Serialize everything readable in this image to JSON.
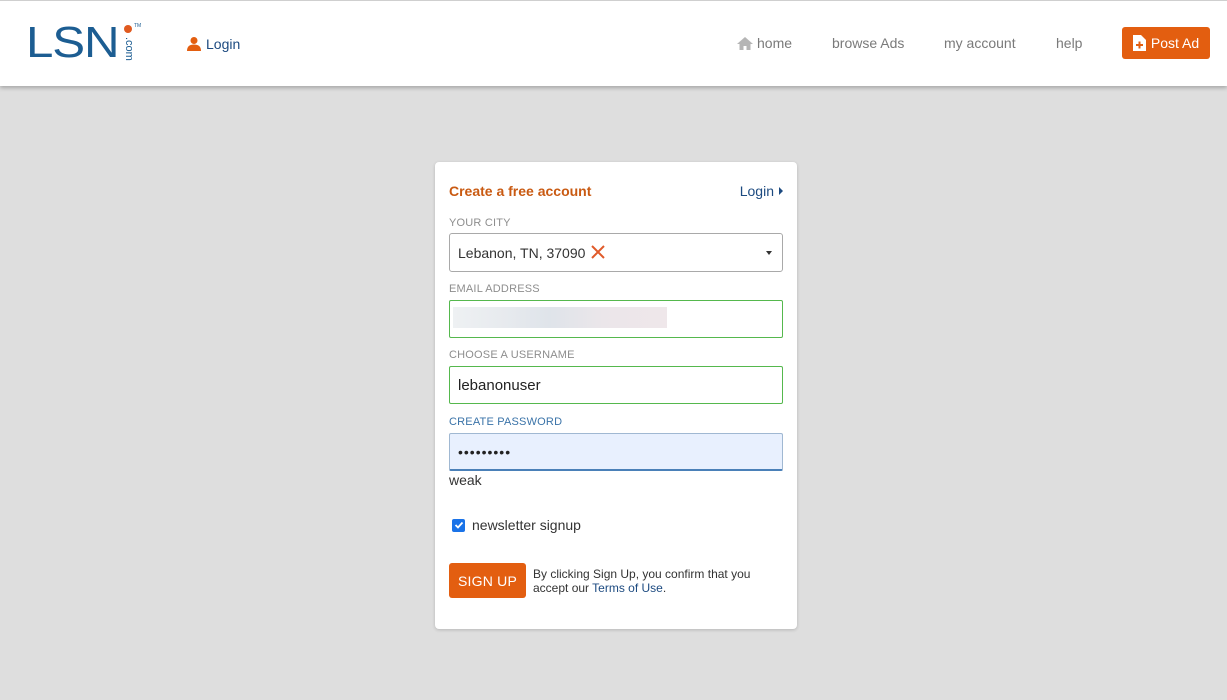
{
  "header": {
    "logo_text": "LSN",
    "logo_suffix": ".com",
    "logo_tm": "TM",
    "login_label": "Login",
    "nav": {
      "home": "home",
      "browse": "browse Ads",
      "account": "my account",
      "help": "help"
    },
    "post_ad_label": "Post Ad"
  },
  "form": {
    "title": "Create a free account",
    "login_link": "Login",
    "city_label": "YOUR CITY",
    "city_value": "Lebanon, TN, 37090",
    "email_label": "EMAIL ADDRESS",
    "email_value": "",
    "username_label": "CHOOSE A USERNAME",
    "username_value": "lebanonuser",
    "password_label": "CREATE PASSWORD",
    "password_value": "•••••••••",
    "password_strength": "weak",
    "newsletter_label": "newsletter signup",
    "newsletter_checked": true,
    "signup_label": "SIGN UP",
    "terms_prefix": "By clicking Sign Up, you confirm that you accept our ",
    "terms_link": "Terms of Use",
    "terms_suffix": "."
  },
  "colors": {
    "brand_blue": "#1c5d92",
    "accent_orange": "#e35e10",
    "valid_green": "#55b84d",
    "background": "#dedede"
  }
}
